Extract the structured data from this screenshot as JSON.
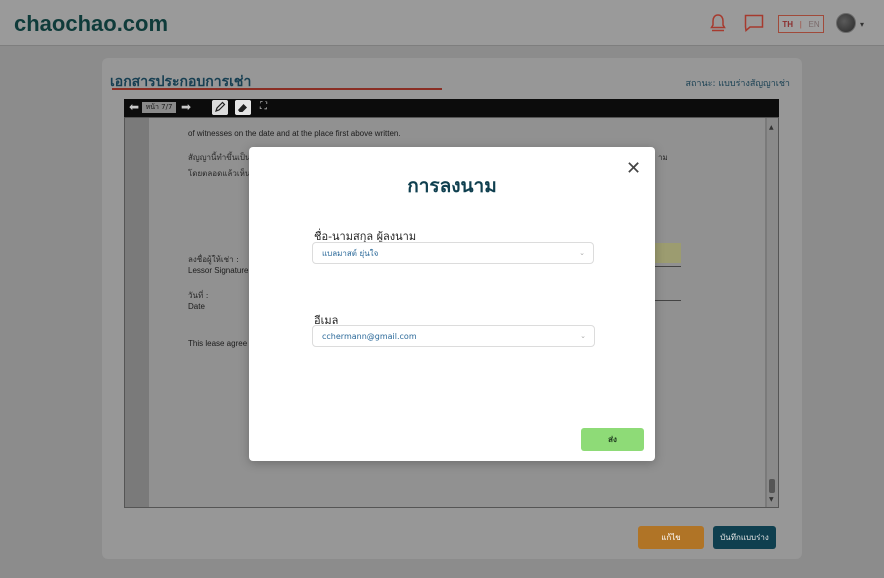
{
  "app": {
    "logo": "chaochao.com"
  },
  "header": {
    "lang_th": "TH",
    "lang_sep": "|",
    "lang_en": "EN",
    "avatar_caret": "▾"
  },
  "page": {
    "title": "เอกสารประกอบการเช่า",
    "status": "สถานะ: แบบร่างสัญญาเช่า"
  },
  "viewer": {
    "prev_icon": "⬅",
    "next_icon": "➡",
    "page_indicator": "หน้า 7/7",
    "expand_icon": "⛶",
    "scroll_up": "▲",
    "scroll_down": "▼"
  },
  "document": {
    "line1": "of witnesses on the date and at the place first above written.",
    "line2_th": "สัญญานี้ทำขึ้นเป็น",
    "line2_tail": "าม",
    "line3_th": "โดยตลอดแล้วเห็น",
    "lessor_th": "ลงชื่อผู้ให้เช่า :",
    "lessor_en": "Lessor Signature",
    "date_th": "วันที่ :",
    "date_en": "Date",
    "agreement": "This lease agree"
  },
  "actions": {
    "edit": "แก้ไข",
    "save_draft": "บันทึกแบบร่าง"
  },
  "modal": {
    "close_icon": "✕",
    "title": "การลงนาม",
    "name_label": "ชื่อ-นามสกุล ผู้ลงนาม",
    "name_value": "แบลมาสต์ ยุ่นใจ",
    "email_label": "อีเมล",
    "email_value": "cchermann@gmail.com",
    "send": "ส่ง"
  },
  "colors": {
    "brand_dark": "#0f3f4f",
    "accent_red": "#8a2e24",
    "edit_orange": "#b07426",
    "send_green": "#8edb77"
  }
}
